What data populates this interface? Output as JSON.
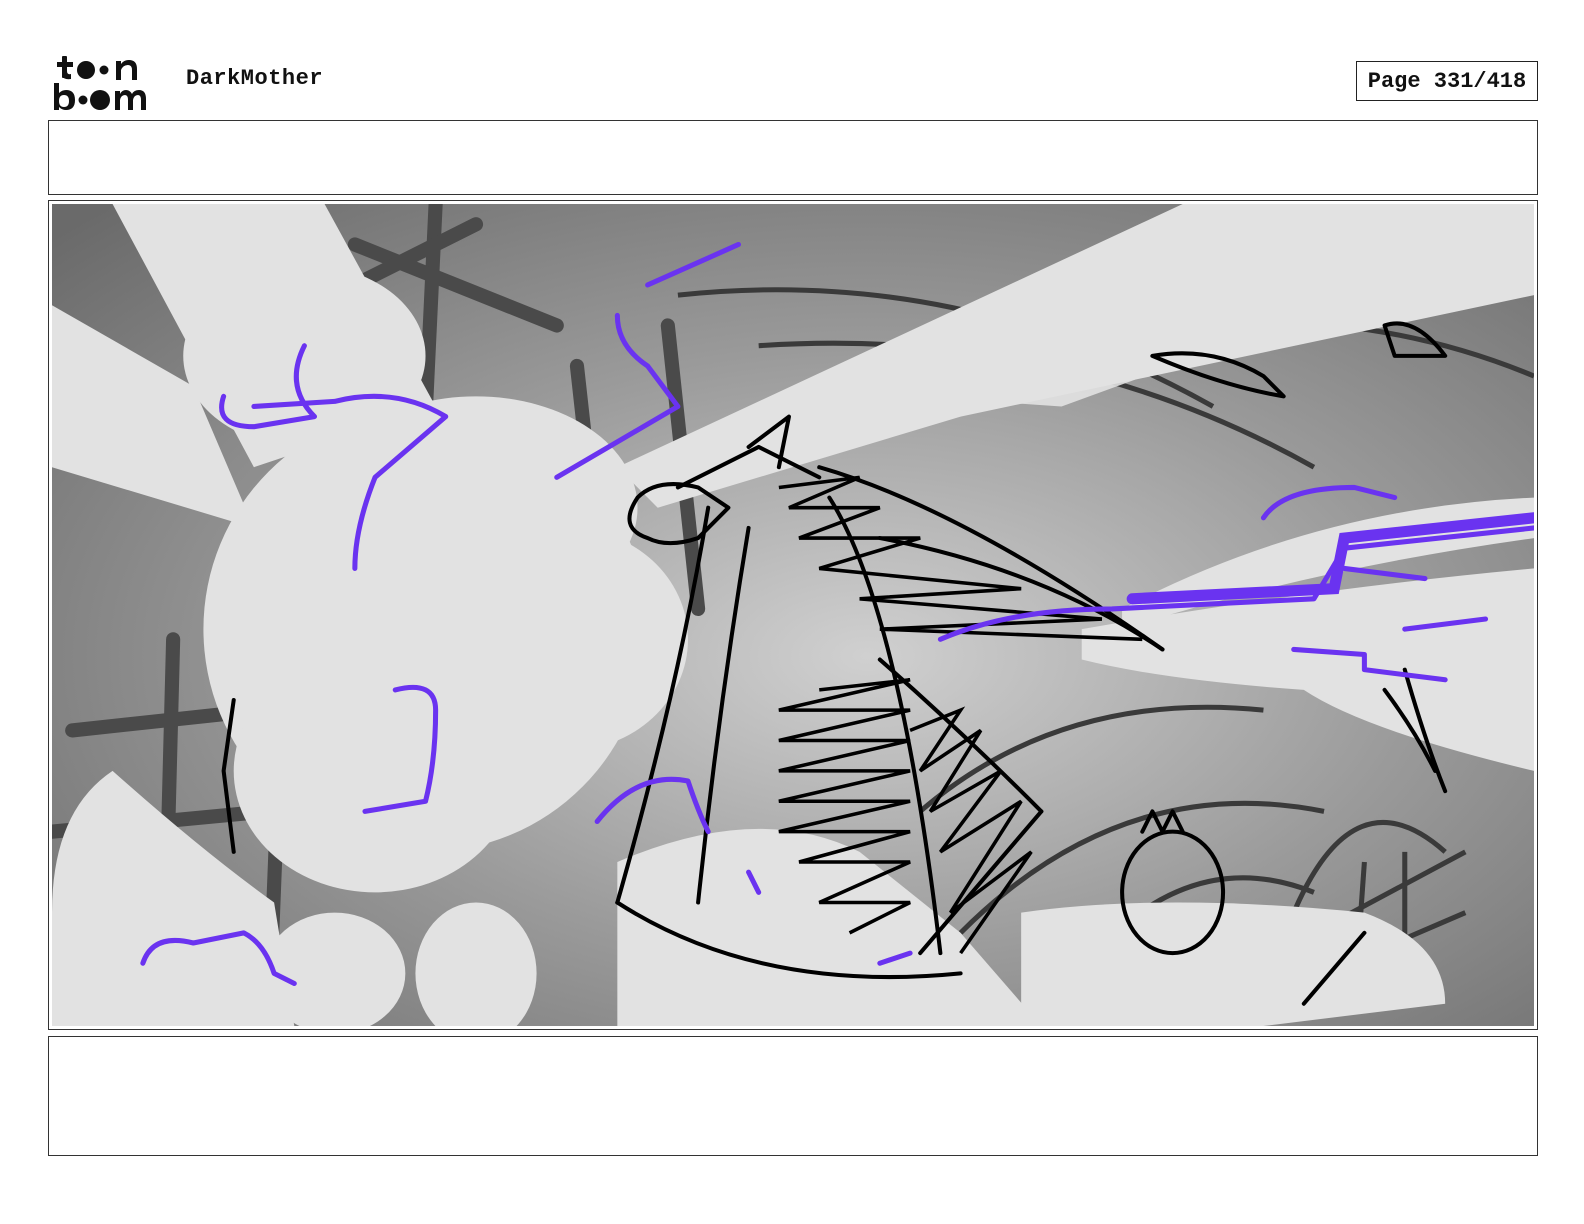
{
  "header": {
    "logo_text_top": "toon",
    "logo_text_bottom": "boom",
    "project_title": "DarkMother",
    "page_indicator": "Page 331/418"
  },
  "panel": {
    "action_notes": "",
    "dialogue_notes": ""
  },
  "colors": {
    "sketch_line": "#000000",
    "effect_line": "#6a33f0",
    "light_fill": "#e2e2e2",
    "mid_fill": "#9a9a9a",
    "dark_fill": "#555555"
  }
}
